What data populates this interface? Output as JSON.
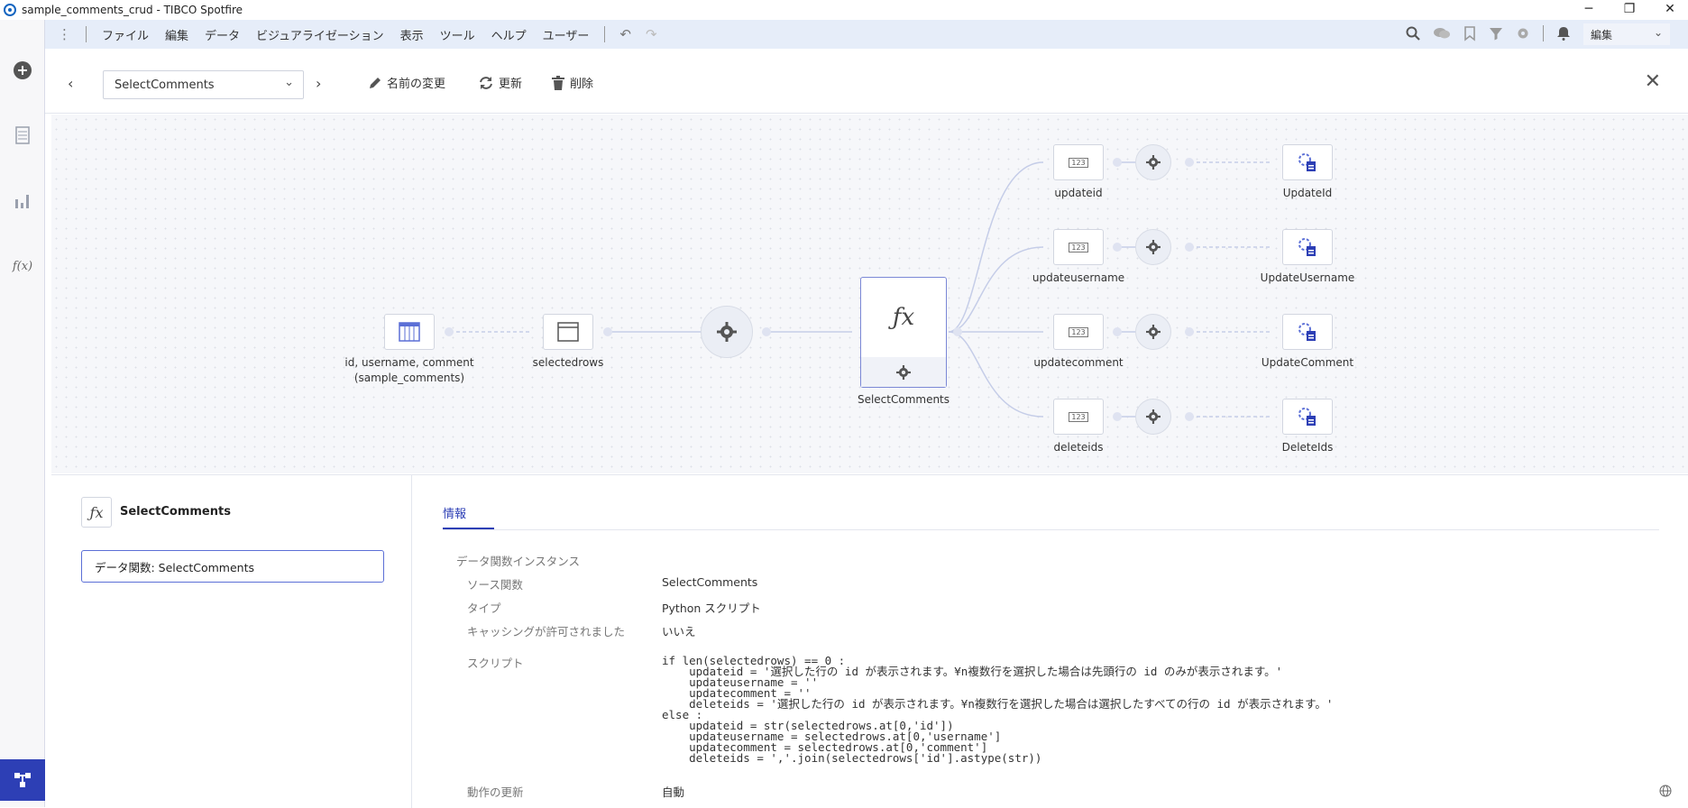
{
  "window": {
    "title": "sample_comments_crud - TIBCO Spotfire",
    "minimize": "─",
    "restore": "❐",
    "close": "✕"
  },
  "menu": {
    "items": [
      "ファイル",
      "編集",
      "データ",
      "ビジュアライゼーション",
      "表示",
      "ツール",
      "ヘルプ",
      "ユーザー"
    ],
    "edit_mode": "編集"
  },
  "toolbar": {
    "selected_function": "SelectComments",
    "rename": "名前の変更",
    "refresh": "更新",
    "delete": "削除"
  },
  "graph": {
    "source_table_label_line1": "id, username, comment",
    "source_table_label_line2": "(sample_comments)",
    "selectedrows": "selectedrows",
    "function_name": "SelectComments",
    "outputs": [
      {
        "value": "updateid",
        "target": "UpdateId"
      },
      {
        "value": "updateusername",
        "target": "UpdateUsername"
      },
      {
        "value": "updatecomment",
        "target": "UpdateComment"
      },
      {
        "value": "deleteids",
        "target": "DeleteIds"
      }
    ],
    "value_icon_text": "123"
  },
  "detail": {
    "header_name": "SelectComments",
    "list_item": "データ関数: SelectComments",
    "tab_info": "情報",
    "section_title": "データ関数インスタンス",
    "source_function_label": "ソース関数",
    "source_function_value": "SelectComments",
    "type_label": "タイプ",
    "type_value": "Python スクリプト",
    "caching_label": "キャッシングが許可されました",
    "caching_value": "いいえ",
    "script_label": "スクリプト",
    "script": "if len(selectedrows) == 0 :\n    updateid = '選択した行の id が表示されます。¥n複数行を選択した場合は先頭行の id のみが表示されます。'\n    updateusername = ''\n    updatecomment = ''\n    deleteids = '選択した行の id が表示されます。¥n複数行を選択した場合は選択したすべての行の id が表示されます。'\nelse :\n    updateid = str(selectedrows.at[0,'id'])\n    updateusername = selectedrows.at[0,'username']\n    updatecomment = selectedrows.at[0,'comment']\n    deleteids = ','.join(selectedrows['id'].astype(str))",
    "update_label": "動作の更新",
    "update_value": "自動"
  },
  "icons": {
    "add": "plus-circle-icon",
    "pages": "page-list-icon",
    "visualizations": "bar-chart-icon",
    "functions": "fx-icon",
    "dataflow": "data-canvas-icon"
  }
}
